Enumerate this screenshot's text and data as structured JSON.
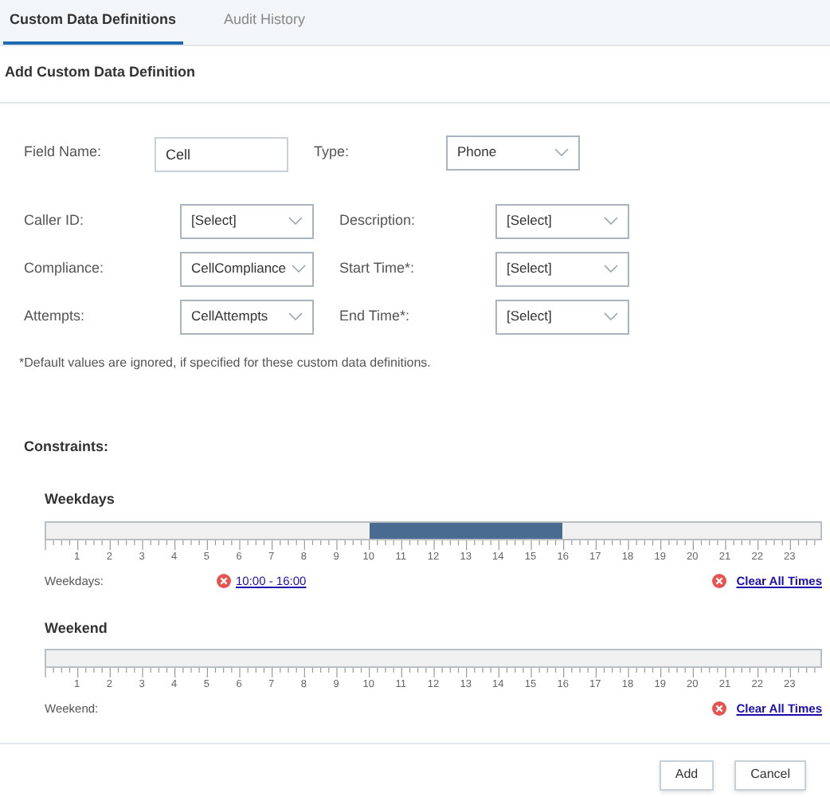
{
  "tabs": [
    {
      "label": "Custom Data Definitions",
      "selected": true
    },
    {
      "label": "Audit History",
      "selected": false
    }
  ],
  "heading": "Add Custom Data Definition",
  "top_row": [
    {
      "label": "Field Name:",
      "kind": "text",
      "value": "Cell"
    },
    {
      "label": "Type:",
      "kind": "select",
      "value": "Phone"
    }
  ],
  "grid_rows": [
    [
      {
        "label": "Caller ID:",
        "value": "[Select]"
      },
      {
        "label": "Description:",
        "value": "[Select]"
      }
    ],
    [
      {
        "label": "Compliance:",
        "value": "CellCompliance"
      },
      {
        "label": "Start Time*:",
        "value": "[Select]"
      }
    ],
    [
      {
        "label": "Attempts:",
        "value": "CellAttempts"
      },
      {
        "label": "End Time*:",
        "value": "[Select]"
      }
    ]
  ],
  "note": "*Default values are ignored, if specified for these custom data definitions.",
  "constraints_title": "Constraints:",
  "timelines": [
    {
      "title": "Weekdays",
      "hour_labels": [
        "1",
        "2",
        "3",
        "4",
        "5",
        "6",
        "7",
        "8",
        "9",
        "10",
        "11",
        "12",
        "13",
        "14",
        "15",
        "16",
        "17",
        "18",
        "19",
        "20",
        "21",
        "22",
        "23"
      ],
      "hour_slots": [
        {
          "selected": false
        },
        {
          "selected": false
        },
        {
          "selected": false
        },
        {
          "selected": false
        },
        {
          "selected": false
        },
        {
          "selected": false
        },
        {
          "selected": false
        },
        {
          "selected": false
        },
        {
          "selected": false
        },
        {
          "selected": false
        },
        {
          "selected": true
        },
        {
          "selected": true
        },
        {
          "selected": true
        },
        {
          "selected": true
        },
        {
          "selected": true
        },
        {
          "selected": true
        },
        {
          "selected": false
        },
        {
          "selected": false
        },
        {
          "selected": false
        },
        {
          "selected": false
        },
        {
          "selected": false
        },
        {
          "selected": false
        },
        {
          "selected": false
        },
        {
          "selected": false
        }
      ],
      "ranges": [
        {
          "label": "10:00 - 16:00"
        }
      ],
      "row_label": "Weekdays:",
      "clear_link": "Clear All Times"
    },
    {
      "title": "Weekend",
      "hour_labels": [
        "1",
        "2",
        "3",
        "4",
        "5",
        "6",
        "7",
        "8",
        "9",
        "10",
        "11",
        "12",
        "13",
        "14",
        "15",
        "16",
        "17",
        "18",
        "19",
        "20",
        "21",
        "22",
        "23"
      ],
      "hour_slots": [
        {
          "selected": false
        },
        {
          "selected": false
        },
        {
          "selected": false
        },
        {
          "selected": false
        },
        {
          "selected": false
        },
        {
          "selected": false
        },
        {
          "selected": false
        },
        {
          "selected": false
        },
        {
          "selected": false
        },
        {
          "selected": false
        },
        {
          "selected": false
        },
        {
          "selected": false
        },
        {
          "selected": false
        },
        {
          "selected": false
        },
        {
          "selected": false
        },
        {
          "selected": false
        },
        {
          "selected": false
        },
        {
          "selected": false
        },
        {
          "selected": false
        },
        {
          "selected": false
        },
        {
          "selected": false
        },
        {
          "selected": false
        },
        {
          "selected": false
        },
        {
          "selected": false
        }
      ],
      "row_label": "Weekend:",
      "clear_link": "Clear All Times"
    }
  ],
  "buttons": [
    "Add",
    "Cancel"
  ]
}
